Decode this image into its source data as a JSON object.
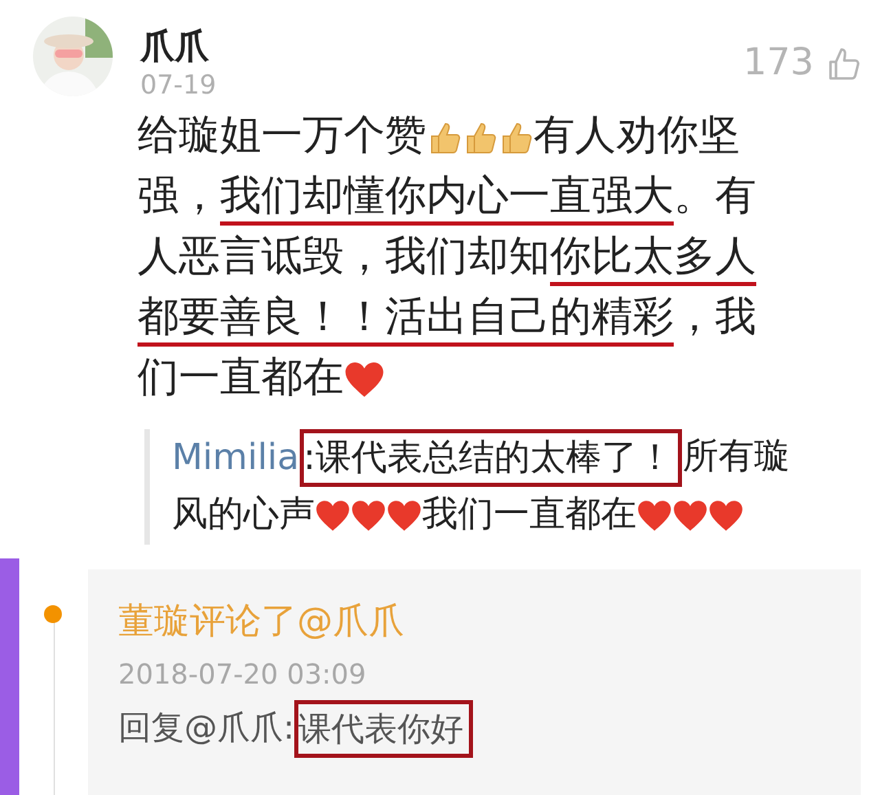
{
  "comment": {
    "author": "爪爪",
    "date": "07-19",
    "likes": "173",
    "lines": [
      [
        {
          "kind": "text",
          "text": "给璇姐一万个赞",
          "underlined": false,
          "boxed": false
        },
        {
          "kind": "thumb"
        },
        {
          "kind": "thumb"
        },
        {
          "kind": "thumb"
        },
        {
          "kind": "text",
          "text": "有人劝你坚",
          "underlined": false,
          "boxed": false
        }
      ],
      [
        {
          "kind": "text",
          "text": "强，",
          "underlined": false,
          "boxed": false
        },
        {
          "kind": "text",
          "text": "我们却懂你内心一直强大",
          "underlined": true,
          "boxed": false
        },
        {
          "kind": "text",
          "text": "。有",
          "underlined": false,
          "boxed": false
        }
      ],
      [
        {
          "kind": "text",
          "text": "人恶言诋毁，我们却知",
          "underlined": false,
          "boxed": false
        },
        {
          "kind": "text",
          "text": "你比太多人",
          "underlined": true,
          "boxed": false
        }
      ],
      [
        {
          "kind": "text",
          "text": "都要善良！！活出自己的精彩",
          "underlined": true,
          "boxed": false
        },
        {
          "kind": "text",
          "text": "，我",
          "underlined": false,
          "boxed": false
        }
      ],
      [
        {
          "kind": "text",
          "text": "们一直都在",
          "underlined": false,
          "boxed": false
        },
        {
          "kind": "heart"
        }
      ]
    ],
    "quote": {
      "user": "Mimilia",
      "lines": [
        [
          {
            "kind": "text",
            "text": ":课代表总结的太棒了！",
            "underlined": false,
            "boxed": true
          },
          {
            "kind": "text",
            "text": " 所有璇",
            "underlined": false,
            "boxed": false
          }
        ],
        [
          {
            "kind": "text",
            "text": "风的心声",
            "underlined": false,
            "boxed": false
          },
          {
            "kind": "heart"
          },
          {
            "kind": "heart"
          },
          {
            "kind": "heart"
          },
          {
            "kind": "text",
            "text": "我们一直都在",
            "underlined": false,
            "boxed": false
          },
          {
            "kind": "heart"
          },
          {
            "kind": "heart"
          },
          {
            "kind": "heart"
          }
        ]
      ]
    }
  },
  "notification": {
    "title": "董璇评论了@爪爪",
    "time": "2018-07-20 03:09",
    "reply": [
      {
        "kind": "text",
        "text": "回复@爪爪:",
        "underlined": false,
        "boxed": false
      },
      {
        "kind": "text",
        "text": "课代表你好",
        "underlined": false,
        "boxed": true
      }
    ]
  }
}
